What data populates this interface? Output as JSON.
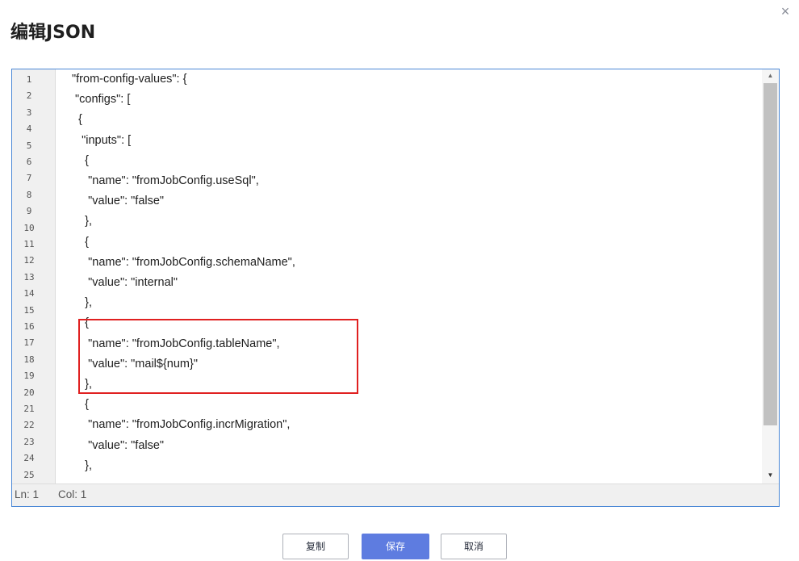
{
  "dialog": {
    "title": "编辑JSON",
    "close_glyph": "×"
  },
  "editor": {
    "line_numbers": [
      "1",
      "2",
      "3",
      "4",
      "5",
      "6",
      "7",
      "8",
      "9",
      "10",
      "11",
      "12",
      "13",
      "14",
      "15",
      "16",
      "17",
      "18",
      "19",
      "20",
      "21",
      "22",
      "23",
      "24",
      "25"
    ],
    "code_lines": [
      "\"from-config-values\": {",
      " \"configs\": [",
      "  {",
      "   \"inputs\": [",
      "    {",
      "     \"name\": \"fromJobConfig.useSql\",",
      "     \"value\": \"false\"",
      "    },",
      "    {",
      "     \"name\": \"fromJobConfig.schemaName\",",
      "     \"value\": \"internal\"",
      "    },",
      "    {",
      "     \"name\": \"fromJobConfig.tableName\",",
      "     \"value\": \"mail${num}\"",
      "    },",
      "    {",
      "     \"name\": \"fromJobConfig.incrMigration\",",
      "     \"value\": \"false\"",
      "    },"
    ],
    "scroll_up_glyph": "▲",
    "scroll_down_glyph": "▼",
    "status": {
      "ln": "Ln: 1",
      "col": "Col: 1"
    }
  },
  "buttons": {
    "copy": "复制",
    "save": "保存",
    "cancel": "取消"
  },
  "colors": {
    "editor_border": "#4a87d6",
    "highlight_border": "#e02020",
    "primary_button": "#5e7ce0"
  }
}
